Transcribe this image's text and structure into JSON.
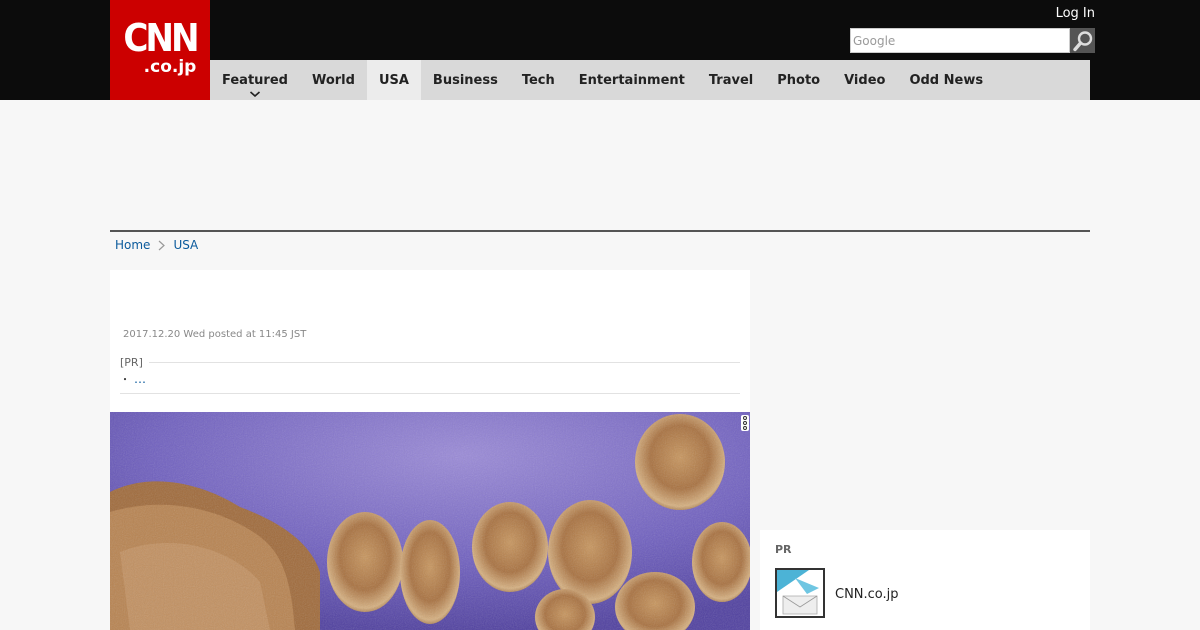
{
  "header": {
    "logo_main": "CNN",
    "logo_sub": ".co.jp",
    "login_label": "Log In",
    "search_placeholder": "Google"
  },
  "nav": {
    "items": [
      {
        "label": "Featured",
        "has_dropdown": true
      },
      {
        "label": "World"
      },
      {
        "label": "USA",
        "active": true
      },
      {
        "label": "Business"
      },
      {
        "label": "Tech"
      },
      {
        "label": "Entertainment"
      },
      {
        "label": "Travel"
      },
      {
        "label": "Photo"
      },
      {
        "label": "Video"
      },
      {
        "label": "Odd News"
      }
    ]
  },
  "breadcrumb": {
    "home": "Home",
    "current": "USA"
  },
  "article": {
    "dateline": "2017.12.20 Wed posted at 11:45 JST",
    "pr_label": "[PR]",
    "pr_bullet": "・",
    "pr_link": "…"
  },
  "sidebar": {
    "pr_label": "PR",
    "item_title": "CNN.co.jp"
  },
  "colors": {
    "brand_red": "#cc0000",
    "header_bg": "#0c0c0c",
    "nav_bg": "#d9d9d9",
    "link": "#0a5a9c"
  }
}
